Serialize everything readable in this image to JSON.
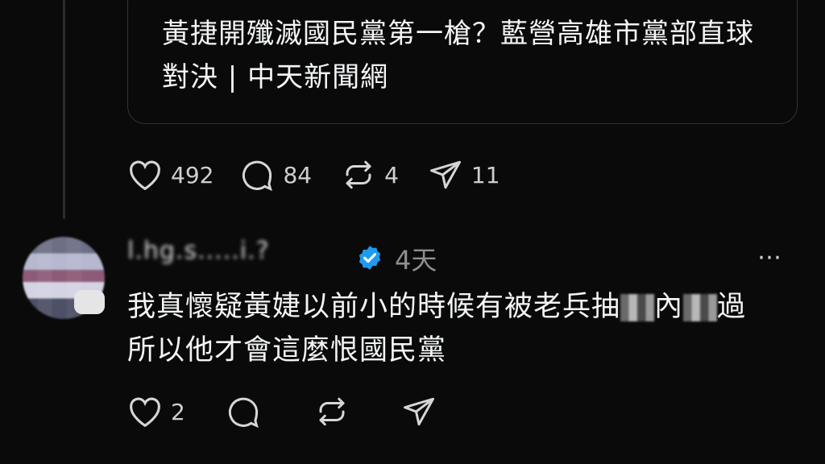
{
  "parent_post": {
    "link_card": {
      "title": "黃捷開殲滅國民黨第一槍？藍營高雄市黨部直球對決 | 中天新聞網"
    },
    "actions": {
      "like_count": "492",
      "comment_count": "84",
      "repost_count": "4",
      "share_count": "11"
    }
  },
  "reply": {
    "username": "l.hg.s.....i.?",
    "time": "4天",
    "more_icon": "⋯",
    "text_line1_a": "我真懷疑黃婕以前小的時候有被老兵抽",
    "text_line1_b": "內",
    "text_line1_c": "過",
    "text_line2": "所以他才會這麼恨國民黨",
    "actions": {
      "like_count": "2"
    }
  },
  "colors": {
    "background": "#0a0a0a",
    "text": "#f3f5f7",
    "muted": "#8f8f8f",
    "verified": "#1d9bf0"
  }
}
